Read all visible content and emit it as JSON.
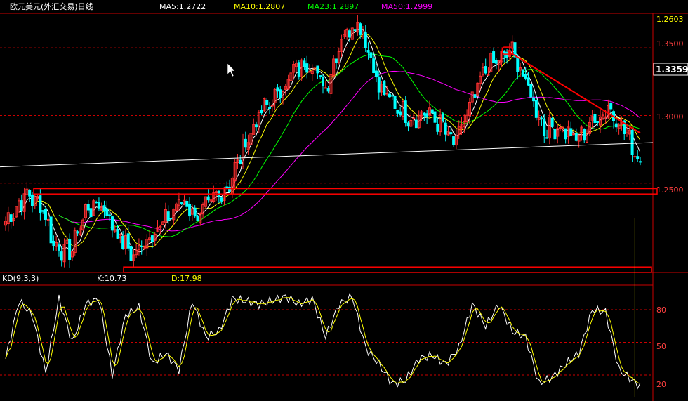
{
  "header": {
    "title": "欧元美元(外汇交易)日线",
    "ma5": "MA5:1.2722",
    "ma10": "MA10:1.2807",
    "ma23": "MA23:1.2897",
    "ma50": "MA50:1.2999"
  },
  "price_axis": {
    "ticks": [
      "1.3500",
      "1.3000",
      "1.2500"
    ],
    "high_label": "1.2603",
    "current_label": "1.3359"
  },
  "kd_panel": {
    "title": "KD(9,3,3)",
    "k_label": "K:10.73",
    "d_label": "D:17.98",
    "ticks": [
      "80",
      "50",
      "20"
    ]
  },
  "colors": {
    "background": "#000000",
    "up": "#ff3030",
    "down": "#00ffff",
    "ma5": "#ffffff",
    "ma10": "#ffff00",
    "ma23": "#00ff00",
    "ma50": "#ff00ff",
    "annotation": "#ff0000",
    "grid": "#cc0000"
  },
  "chart_data": [
    {
      "type": "candlestick",
      "title": "欧元美元(外汇交易)日线",
      "ylim": [
        1.185,
        1.375
      ],
      "y_ticks": [
        1.35,
        1.3,
        1.25
      ],
      "anchors": [
        [
          0,
          1.222
        ],
        [
          8,
          1.242
        ],
        [
          14,
          1.232
        ],
        [
          18,
          1.205
        ],
        [
          24,
          1.198
        ],
        [
          30,
          1.23
        ],
        [
          36,
          1.235
        ],
        [
          42,
          1.212
        ],
        [
          48,
          1.196
        ],
        [
          54,
          1.212
        ],
        [
          60,
          1.222
        ],
        [
          66,
          1.238
        ],
        [
          72,
          1.225
        ],
        [
          78,
          1.238
        ],
        [
          84,
          1.25
        ],
        [
          90,
          1.28
        ],
        [
          96,
          1.303
        ],
        [
          102,
          1.315
        ],
        [
          108,
          1.333
        ],
        [
          114,
          1.34
        ],
        [
          120,
          1.32
        ],
        [
          126,
          1.358
        ],
        [
          132,
          1.37
        ],
        [
          136,
          1.35
        ],
        [
          140,
          1.32
        ],
        [
          146,
          1.308
        ],
        [
          152,
          1.298
        ],
        [
          158,
          1.302
        ],
        [
          164,
          1.292
        ],
        [
          168,
          1.278
        ],
        [
          174,
          1.305
        ],
        [
          180,
          1.335
        ],
        [
          186,
          1.342
        ],
        [
          190,
          1.348
        ],
        [
          196,
          1.32
        ],
        [
          202,
          1.29
        ],
        [
          208,
          1.292
        ],
        [
          214,
          1.282
        ],
        [
          220,
          1.295
        ],
        [
          226,
          1.306
        ],
        [
          232,
          1.29
        ],
        [
          238,
          1.265
        ]
      ],
      "series": [
        {
          "name": "MA5",
          "latest": 1.2722
        },
        {
          "name": "MA10",
          "latest": 1.2807
        },
        {
          "name": "MA23",
          "latest": 1.2897
        },
        {
          "name": "MA50",
          "latest": 1.2999
        }
      ]
    },
    {
      "type": "line",
      "title": "KD(9,3,3)",
      "ylim": [
        0,
        100
      ],
      "y_ticks": [
        80,
        50,
        20
      ],
      "k_anchors": [
        [
          0,
          35
        ],
        [
          5,
          88
        ],
        [
          10,
          75
        ],
        [
          15,
          22
        ],
        [
          20,
          90
        ],
        [
          25,
          50
        ],
        [
          30,
          85
        ],
        [
          35,
          90
        ],
        [
          40,
          20
        ],
        [
          45,
          75
        ],
        [
          50,
          82
        ],
        [
          55,
          30
        ],
        [
          60,
          40
        ],
        [
          65,
          25
        ],
        [
          70,
          88
        ],
        [
          75,
          55
        ],
        [
          80,
          60
        ],
        [
          85,
          90
        ],
        [
          90,
          88
        ],
        [
          95,
          85
        ],
        [
          100,
          88
        ],
        [
          105,
          92
        ],
        [
          110,
          85
        ],
        [
          115,
          90
        ],
        [
          120,
          55
        ],
        [
          125,
          85
        ],
        [
          130,
          92
        ],
        [
          135,
          45
        ],
        [
          140,
          30
        ],
        [
          145,
          12
        ],
        [
          150,
          15
        ],
        [
          155,
          35
        ],
        [
          160,
          38
        ],
        [
          165,
          30
        ],
        [
          170,
          45
        ],
        [
          175,
          85
        ],
        [
          180,
          65
        ],
        [
          185,
          85
        ],
        [
          190,
          60
        ],
        [
          195,
          55
        ],
        [
          200,
          12
        ],
        [
          205,
          18
        ],
        [
          210,
          30
        ],
        [
          215,
          40
        ],
        [
          220,
          80
        ],
        [
          225,
          78
        ],
        [
          230,
          25
        ],
        [
          235,
          15
        ],
        [
          238,
          10
        ]
      ],
      "series": [
        {
          "name": "K",
          "latest": 10.73
        },
        {
          "name": "D",
          "latest": 17.98
        }
      ]
    }
  ]
}
